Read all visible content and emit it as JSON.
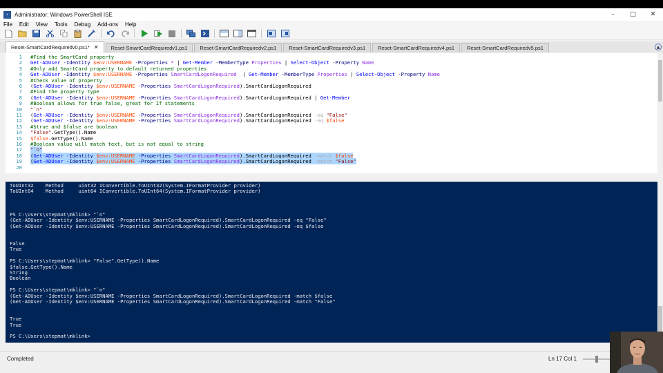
{
  "window": {
    "title": "Administrator: Windows PowerShell ISE",
    "controls": {
      "minimize": "–",
      "maximize": "□",
      "close": "✕"
    }
  },
  "menu": [
    "File",
    "Edit",
    "View",
    "Tools",
    "Debug",
    "Add-ons",
    "Help"
  ],
  "toolbar_icons": [
    "new-file-icon",
    "open-file-icon",
    "save-icon",
    "cut-icon",
    "copy-icon",
    "paste-icon",
    "clear-icon",
    "undo-icon",
    "redo-icon",
    "run-script-icon",
    "run-selection-icon",
    "stop-icon",
    "new-remote-tab-icon",
    "start-powershell-icon",
    "show-script-top-icon",
    "show-script-right-icon",
    "show-script-maximized-icon",
    "show-command-window-icon",
    "show-command-addon-icon"
  ],
  "tabs": [
    {
      "label": "Reset-SmartCardRequiredv0.ps1*",
      "active": true
    },
    {
      "label": "Reset-SmartCardRequiredv1.ps1",
      "active": false
    },
    {
      "label": "Reset-SmartCardRequiredv2.ps1",
      "active": false
    },
    {
      "label": "Reset-SmartCardRequiredv3.ps1",
      "active": false
    },
    {
      "label": "Reset-SmartCardRequiredv4.ps1",
      "active": false
    },
    {
      "label": "Reset-SmartCardRequiredv5.ps1",
      "active": false
    }
  ],
  "editor": {
    "lines": [
      {
        "n": "1",
        "tokens": [
          [
            "comment",
            "#Find the SmartCard property"
          ]
        ]
      },
      {
        "n": "2",
        "tokens": [
          [
            "cmd",
            "Get-ADUser"
          ],
          [
            "param",
            " -Identity "
          ],
          [
            "var",
            "$env:USERNAME"
          ],
          [
            "param",
            " -Properties "
          ],
          [
            "arg",
            "*"
          ],
          [
            "plain",
            " | "
          ],
          [
            "cmd",
            "Get-Member"
          ],
          [
            "param",
            " -MemberType "
          ],
          [
            "arg",
            "Properties"
          ],
          [
            "plain",
            " | "
          ],
          [
            "cmd",
            "Select-Object"
          ],
          [
            "param",
            " -Property "
          ],
          [
            "arg",
            "Name"
          ]
        ]
      },
      {
        "n": "3",
        "tokens": [
          [
            "comment",
            "#Only add SmartCard property to default returned properties"
          ]
        ]
      },
      {
        "n": "4",
        "tokens": [
          [
            "cmd",
            "Get-ADUser"
          ],
          [
            "param",
            " -Identity "
          ],
          [
            "var",
            "$env:USERNAME"
          ],
          [
            "param",
            " -Properties "
          ],
          [
            "arg",
            "SmartCardLogonRequired"
          ],
          [
            "plain",
            "  | "
          ],
          [
            "cmd",
            "Get-Member"
          ],
          [
            "param",
            " -MemberType "
          ],
          [
            "arg",
            "Properties"
          ],
          [
            "plain",
            " | "
          ],
          [
            "cmd",
            "Select-Object"
          ],
          [
            "param",
            " -Property "
          ],
          [
            "arg",
            "Name"
          ]
        ]
      },
      {
        "n": "5",
        "tokens": [
          [
            "comment",
            "#Check value of property"
          ]
        ]
      },
      {
        "n": "6",
        "tokens": [
          [
            "plain",
            "("
          ],
          [
            "cmd",
            "Get-ADUser"
          ],
          [
            "param",
            " -Identity "
          ],
          [
            "var",
            "$env:USERNAME"
          ],
          [
            "param",
            " -Properties "
          ],
          [
            "arg",
            "SmartCardLogonRequired"
          ],
          [
            "plain",
            ").SmartCardLogonRequired"
          ]
        ]
      },
      {
        "n": "7",
        "tokens": [
          [
            "comment",
            "#Find the property type"
          ]
        ]
      },
      {
        "n": "8",
        "tokens": [
          [
            "plain",
            "("
          ],
          [
            "cmd",
            "Get-ADUser"
          ],
          [
            "param",
            " -Identity "
          ],
          [
            "var",
            "$env:USERNAME"
          ],
          [
            "param",
            " -Properties "
          ],
          [
            "arg",
            "SmartCardLogonRequired"
          ],
          [
            "plain",
            ").SmartCardLogonRequired | "
          ],
          [
            "cmd",
            "Get-Member"
          ]
        ]
      },
      {
        "n": "9",
        "tokens": [
          [
            "comment",
            "#Boolean allows for true false, great for If statements"
          ]
        ]
      },
      {
        "n": "10",
        "tokens": [
          [
            "str",
            "\"`n\""
          ]
        ]
      },
      {
        "n": "11",
        "tokens": [
          [
            "plain",
            "("
          ],
          [
            "cmd",
            "Get-ADUser"
          ],
          [
            "param",
            " -Identity "
          ],
          [
            "var",
            "$env:USERNAME"
          ],
          [
            "param",
            " -Properties "
          ],
          [
            "arg",
            "SmartCardLogonRequired"
          ],
          [
            "plain",
            ").SmartCardLogonRequired "
          ],
          [
            "op",
            "-eq"
          ],
          [
            "str",
            " \"False\""
          ]
        ]
      },
      {
        "n": "12",
        "tokens": [
          [
            "plain",
            "("
          ],
          [
            "cmd",
            "Get-ADUser"
          ],
          [
            "param",
            " -Identity "
          ],
          [
            "var",
            "$env:USERNAME"
          ],
          [
            "param",
            " -Properties "
          ],
          [
            "arg",
            "SmartCardLogonRequired"
          ],
          [
            "plain",
            ").SmartCardLogonRequired "
          ],
          [
            "op",
            "-eq"
          ],
          [
            "var",
            " $false"
          ]
        ]
      },
      {
        "n": "13",
        "tokens": [
          [
            "comment",
            "#$true and $false are boolean"
          ]
        ]
      },
      {
        "n": "14",
        "tokens": [
          [
            "str",
            "\"False\""
          ],
          [
            "plain",
            ".GetType().Name"
          ]
        ]
      },
      {
        "n": "15",
        "tokens": [
          [
            "var",
            "$false"
          ],
          [
            "plain",
            ".GetType().Name"
          ]
        ]
      },
      {
        "n": "16",
        "tokens": [
          [
            "comment",
            "#Boolean value will match text, but is not equal to string"
          ]
        ]
      },
      {
        "n": "17",
        "tokens": [
          [
            "str",
            "\"`n\""
          ]
        ],
        "highlight": true
      },
      {
        "n": "18",
        "tokens": [
          [
            "plain",
            "("
          ],
          [
            "cmd",
            "Get-ADUser"
          ],
          [
            "param",
            " -Identity "
          ],
          [
            "var",
            "$env:USERNAME"
          ],
          [
            "param",
            " -Properties "
          ],
          [
            "arg",
            "SmartCardLogonRequired"
          ],
          [
            "plain",
            ").SmartCardLogonRequired "
          ],
          [
            "op",
            "-match"
          ],
          [
            "var",
            " $false"
          ]
        ],
        "highlight": true
      },
      {
        "n": "19",
        "tokens": [
          [
            "plain",
            "("
          ],
          [
            "cmd",
            "Get-ADUser"
          ],
          [
            "param",
            " -Identity "
          ],
          [
            "var",
            "$env:USERNAME"
          ],
          [
            "param",
            " -Properties "
          ],
          [
            "arg",
            "SmartCardLogonRequired"
          ],
          [
            "plain",
            ").SmartCardLogonRequired "
          ],
          [
            "op",
            "-match"
          ],
          [
            "str",
            " \"False\""
          ]
        ],
        "highlight": true
      },
      {
        "n": "20",
        "tokens": []
      }
    ]
  },
  "console": {
    "lines": [
      "ToUInt32    Method     uint32 IConvertible.ToUInt32(System.IFormatProvider provider)",
      "ToUInt64    Method     uint64 IConvertible.ToUInt64(System.IFormatProvider provider)",
      "",
      "",
      "",
      "PS C:\\Users\\stepmat\\mklink> \"`n\"",
      "(Get-ADUser -Identity $env:USERNAME -Properties SmartCardLogonRequired).SmartCardLogonRequired -eq \"False\"",
      "(Get-ADUser -Identity $env:USERNAME -Properties SmartCardLogonRequired).SmartCardLogonRequired -eq $false",
      "",
      "",
      "False",
      "True",
      "",
      "PS C:\\Users\\stepmat\\mklink> \"False\".GetType().Name",
      "$false.GetType().Name",
      "String",
      "Boolean",
      "",
      "PS C:\\Users\\stepmat\\mklink> \"`n\"",
      "(Get-ADUser -Identity $env:USERNAME -Properties SmartCardLogonRequired).SmartCardLogonRequired -match $false",
      "(Get-ADUser -Identity $env:USERNAME -Properties SmartCardLogonRequired).SmartCardLogonRequired -match \"False\"",
      "",
      "",
      "True",
      "True",
      "",
      "PS C:\\Users\\stepmat\\mklink>"
    ]
  },
  "status": {
    "text": "Completed",
    "position": "Ln 17  Col 1"
  },
  "colors": {
    "console_bg": "#012456",
    "console_fg": "#eeedf0",
    "selection": "#add6ff"
  }
}
